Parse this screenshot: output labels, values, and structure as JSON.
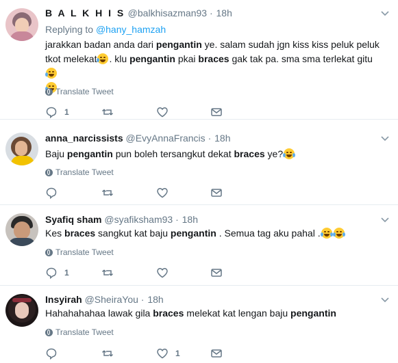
{
  "ui": {
    "translate_label": "Translate Tweet",
    "dot": "·"
  },
  "tweets": [
    {
      "name": "B A L K H I S",
      "handle": "@balkhisazman93",
      "time": "18h",
      "replying_prefix": "Replying to",
      "replying_to": "@hany_hamzah",
      "line1_a": "jarakkan badan anda dari ",
      "line1_b": "pengantin",
      "line1_c": " ye. salam sudah jgn kiss kiss peluk peluk",
      "line2_a": "tkot melekat",
      "line2_b": ". klu ",
      "line2_c": "pengantin",
      "line2_d": " pkai ",
      "line2_e": "braces",
      "line2_f": " gak tak pa. sma sma terlekat gitu",
      "reply_count": "1",
      "retweet_count": "",
      "like_count": ""
    },
    {
      "name": "anna_narcissists",
      "handle": "@EvyAnnaFrancis",
      "time": "18h",
      "t_a": "Baju ",
      "t_b": "pengantin",
      "t_c": " pun boleh tersangkut dekat ",
      "t_d": "braces",
      "t_e": " ye?"
    },
    {
      "name": "Syafiq sham",
      "handle": "@syafiksham93",
      "time": "18h",
      "t_a": "Kes ",
      "t_b": "braces",
      "t_c": " sangkut kat baju ",
      "t_d": "pengantin",
      "t_e": " . Semua tag aku pahal .",
      "reply_count": "1"
    },
    {
      "name": "Insyirah",
      "handle": "@SheiraYou",
      "time": "18h",
      "t_a": "Hahahahahaa lawak gila ",
      "t_b": "braces",
      "t_c": " melekat kat lengan baju ",
      "t_d": "pengantin",
      "like_count": "1"
    }
  ]
}
